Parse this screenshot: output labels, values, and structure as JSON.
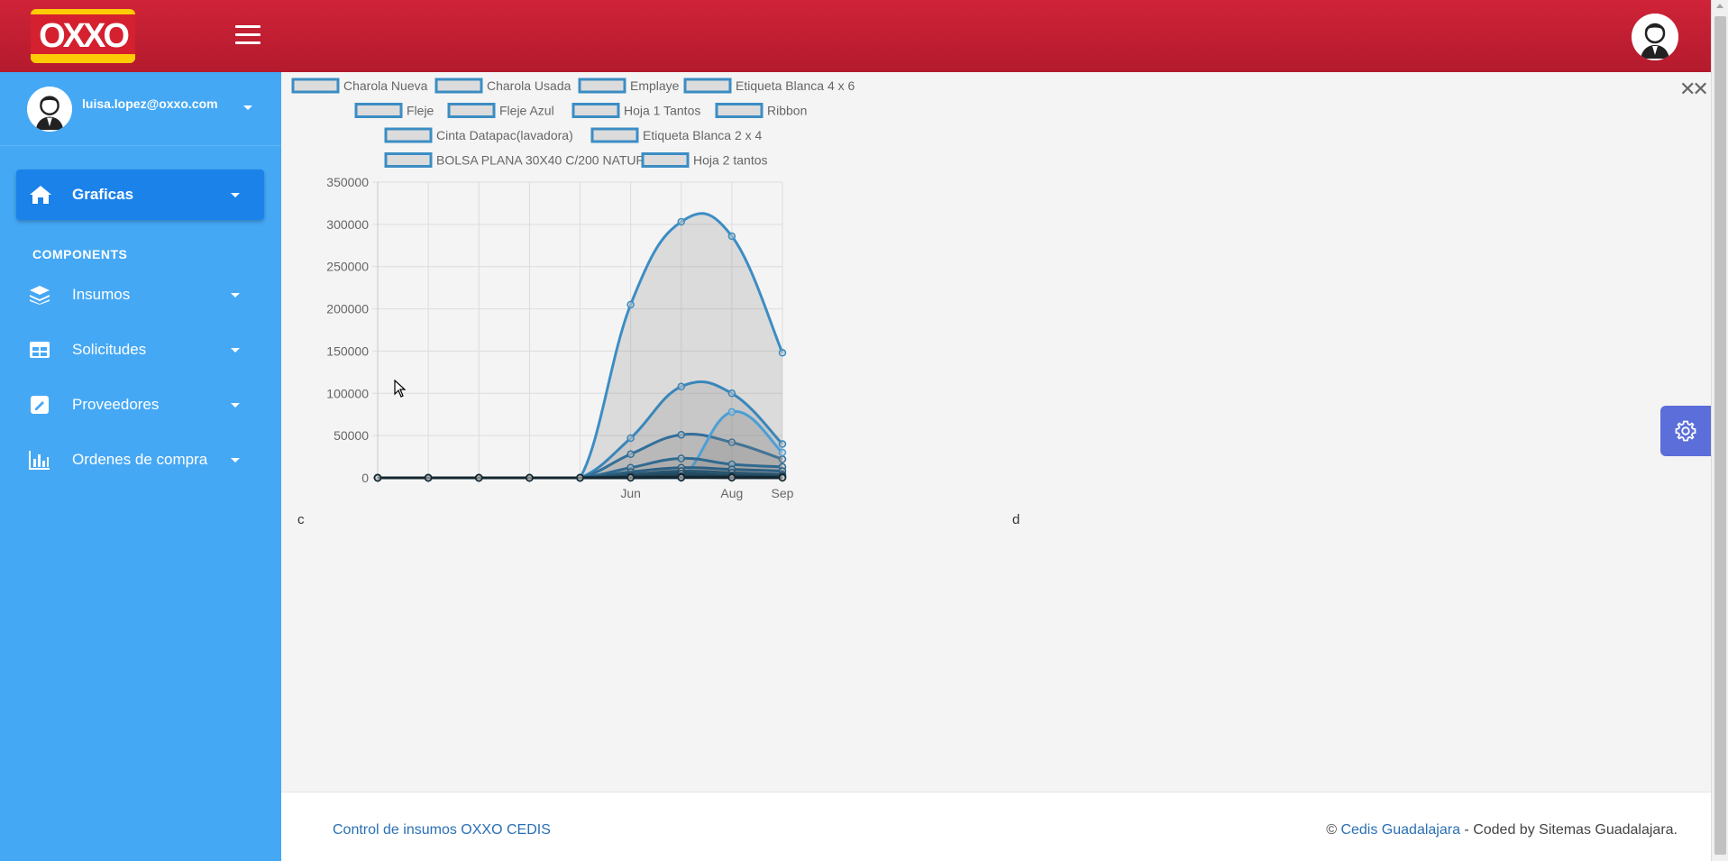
{
  "header": {
    "logo_text": "OXXO",
    "menu_icon": "hamburger-icon",
    "avatar_icon": "user-avatar-icon"
  },
  "sidebar": {
    "user_email": "luisa.lopez@oxxo.com",
    "active_item": {
      "label": "Graficas",
      "icon": "home-icon"
    },
    "section_title": "COMPONENTS",
    "items": [
      {
        "label": "Insumos",
        "icon": "layers-icon"
      },
      {
        "label": "Solicitudes",
        "icon": "table-icon"
      },
      {
        "label": "Proveedores",
        "icon": "edit-icon"
      },
      {
        "label": "Ordenes de compra",
        "icon": "bar-chart-icon"
      }
    ]
  },
  "content": {
    "close_label": "✕✕",
    "corner_left": "c",
    "corner_right": "d"
  },
  "chart_data": {
    "type": "area",
    "x": [
      "",
      "",
      "",
      "",
      "",
      "Jun",
      "",
      "Aug",
      "Sep"
    ],
    "tick_labels": [
      "Jun",
      "Aug",
      "Sep"
    ],
    "ylim": [
      0,
      350000
    ],
    "yticks": [
      "0",
      "50000",
      "100000",
      "150000",
      "200000",
      "250000",
      "300000",
      "350000"
    ],
    "grid": true,
    "legend_placement": "top",
    "legend": [
      "Charola Nueva",
      "Charola Usada",
      "Emplaye",
      "Etiqueta Blanca 4 x 6",
      "Fleje",
      "Fleje Azul",
      "Hoja 1 Tantos",
      "Ribbon",
      "Cinta Datapac(lavadora)",
      "Etiqueta Blanca 2 x 4",
      "BOLSA PLANA 30X40 C/200 NATURAL",
      "Hoja 2 tantos"
    ],
    "series": [
      {
        "name": "Charola Nueva",
        "values": [
          0,
          0,
          0,
          0,
          0,
          205000,
          303000,
          286000,
          148000
        ]
      },
      {
        "name": "Charola Usada",
        "values": [
          0,
          0,
          0,
          0,
          0,
          47000,
          108000,
          100000,
          40000
        ]
      },
      {
        "name": "Emplaye",
        "values": [
          0,
          0,
          0,
          0,
          0,
          28000,
          51000,
          42000,
          22000
        ]
      },
      {
        "name": "Etiqueta Blanca 4 x 6",
        "values": [
          0,
          0,
          0,
          0,
          0,
          0,
          0,
          78000,
          30000
        ]
      },
      {
        "name": "Fleje",
        "values": [
          0,
          0,
          0,
          0,
          0,
          12000,
          23000,
          16000,
          13000
        ]
      },
      {
        "name": "Fleje Azul",
        "values": [
          0,
          0,
          0,
          0,
          0,
          7000,
          12000,
          10000,
          8000
        ]
      },
      {
        "name": "Hoja 1 Tantos",
        "values": [
          0,
          0,
          0,
          0,
          0,
          4000,
          8000,
          6000,
          4000
        ]
      },
      {
        "name": "Ribbon",
        "values": [
          0,
          0,
          0,
          0,
          0,
          2000,
          5000,
          3000,
          2000
        ]
      },
      {
        "name": "Cinta Datapac(lavadora)",
        "values": [
          0,
          0,
          0,
          0,
          0,
          1000,
          2000,
          1500,
          1000
        ]
      },
      {
        "name": "Etiqueta Blanca 2 x 4",
        "values": [
          0,
          0,
          0,
          0,
          0,
          500,
          1000,
          800,
          500
        ]
      },
      {
        "name": "BOLSA PLANA 30X40 C/200 NATURAL",
        "values": [
          0,
          0,
          0,
          0,
          0,
          200,
          500,
          400,
          200
        ]
      },
      {
        "name": "Hoja 2 tantos",
        "values": [
          0,
          0,
          0,
          0,
          0,
          100,
          300,
          200,
          100
        ]
      }
    ],
    "colors": {
      "line": "#3c8dc4",
      "fill": "rgba(130,130,130,0.22)",
      "legend_box_fill": "#dcdcdc",
      "legend_box_stroke": "#3c8dc4"
    }
  },
  "footer": {
    "left_text": "Control de insumos OXXO CEDIS",
    "copyright": "© ",
    "brand_link": "Cedis Guadalajara",
    "right_suffix": " - Coded by Sitemas Guadalajara."
  },
  "colors": {
    "header_red": "#c41f33",
    "sidebar_blue": "#45a8f5",
    "active_blue": "#1b82ea",
    "settings_purple": "#5b6ed9",
    "link_blue": "#2a6fb5"
  }
}
